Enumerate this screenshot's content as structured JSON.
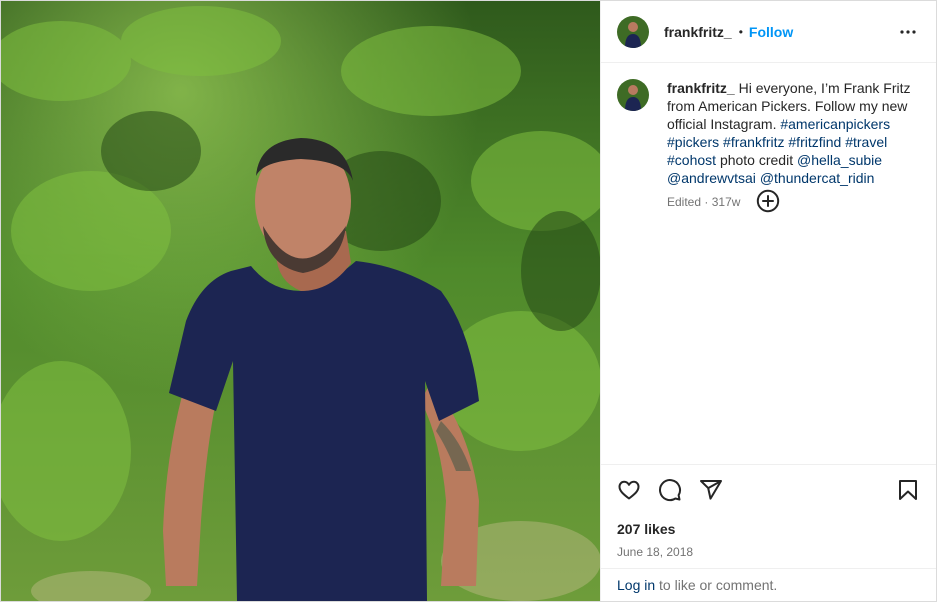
{
  "post": {
    "username": "frankfritz_",
    "follow_label": "Follow",
    "separator": "•",
    "more_icon": "more-horizontal-icon"
  },
  "caption": {
    "username": "frankfritz_",
    "text_intro": "Hi everyone, I’m Frank Fritz from American Pickers. Follow my new official Instagram.",
    "hashtags": [
      "#americanpickers",
      "#pickers",
      "#frankfritz",
      "#fritzfind",
      "#travel",
      "#cohost"
    ],
    "credit_label": "photo credit",
    "mentions": [
      "@hella_subie",
      "@andrewvtsai",
      "@thundercat_ridin"
    ],
    "edited_label": "Edited",
    "meta_separator": "·",
    "age": "317w"
  },
  "add_comment_icon": "plus-circle-icon",
  "actions": {
    "like_icon": "heart-icon",
    "comment_icon": "comment-icon",
    "share_icon": "send-icon",
    "save_icon": "bookmark-icon"
  },
  "likes_text": "207 likes",
  "date_text": "June 18, 2018",
  "login": {
    "link_text": "Log in",
    "rest_text": "to like or comment."
  },
  "colors": {
    "accent": "#0095f6",
    "link": "#00376b",
    "secondary_text": "#737373"
  }
}
